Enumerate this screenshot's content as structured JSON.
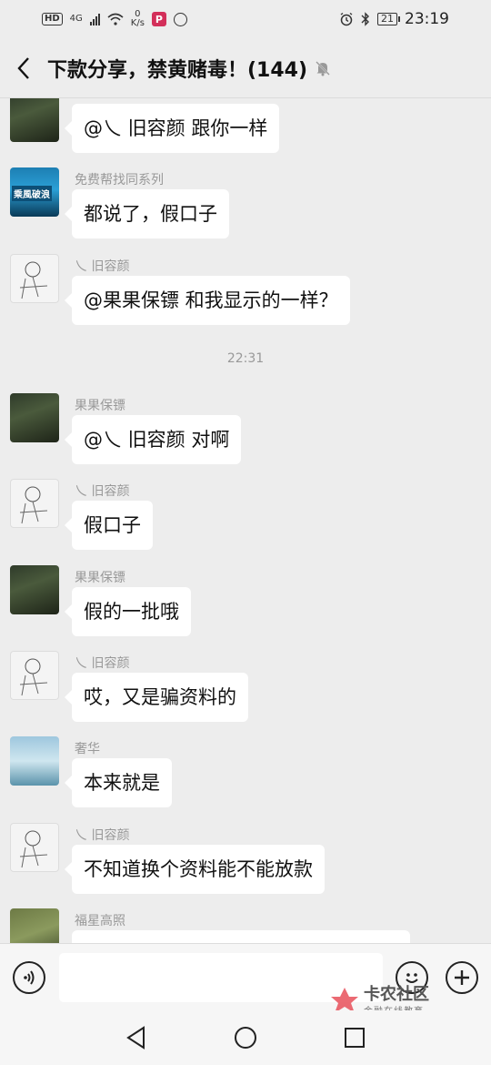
{
  "status_bar": {
    "hd": "HD",
    "network": "4G",
    "speed_value": "0",
    "speed_unit": "K/s",
    "p_badge": "P",
    "battery": "21",
    "time": "23:19"
  },
  "header": {
    "title": "下款分享，禁黄赌毒！(144)"
  },
  "messages": [
    {
      "sender": "",
      "text": "@乀 旧容颜 跟你一样"
    },
    {
      "sender": "免费帮找同系列",
      "text": "都说了，假口子",
      "avatar_text": "乘風破浪"
    },
    {
      "sender": "乀 旧容颜",
      "text": "@果果保镖  和我显示的一样？"
    },
    {
      "sender": "果果保镖",
      "text": "@乀 旧容颜 对啊"
    },
    {
      "sender": "乀 旧容颜",
      "text": "假口子"
    },
    {
      "sender": "果果保镖",
      "text": "假的一批哦"
    },
    {
      "sender": "乀 旧容颜",
      "text": "哎，又是骗资料的"
    },
    {
      "sender": "奢华",
      "text": "本来就是"
    },
    {
      "sender": "乀 旧容颜",
      "text": "不知道换个资料能不能放款"
    },
    {
      "sender": "福星高照",
      "text": ""
    }
  ],
  "timestamp": "22:31",
  "input": {
    "value": "",
    "placeholder": ""
  },
  "watermark": {
    "main": "卡农社区",
    "sub": "金融在线教育"
  }
}
